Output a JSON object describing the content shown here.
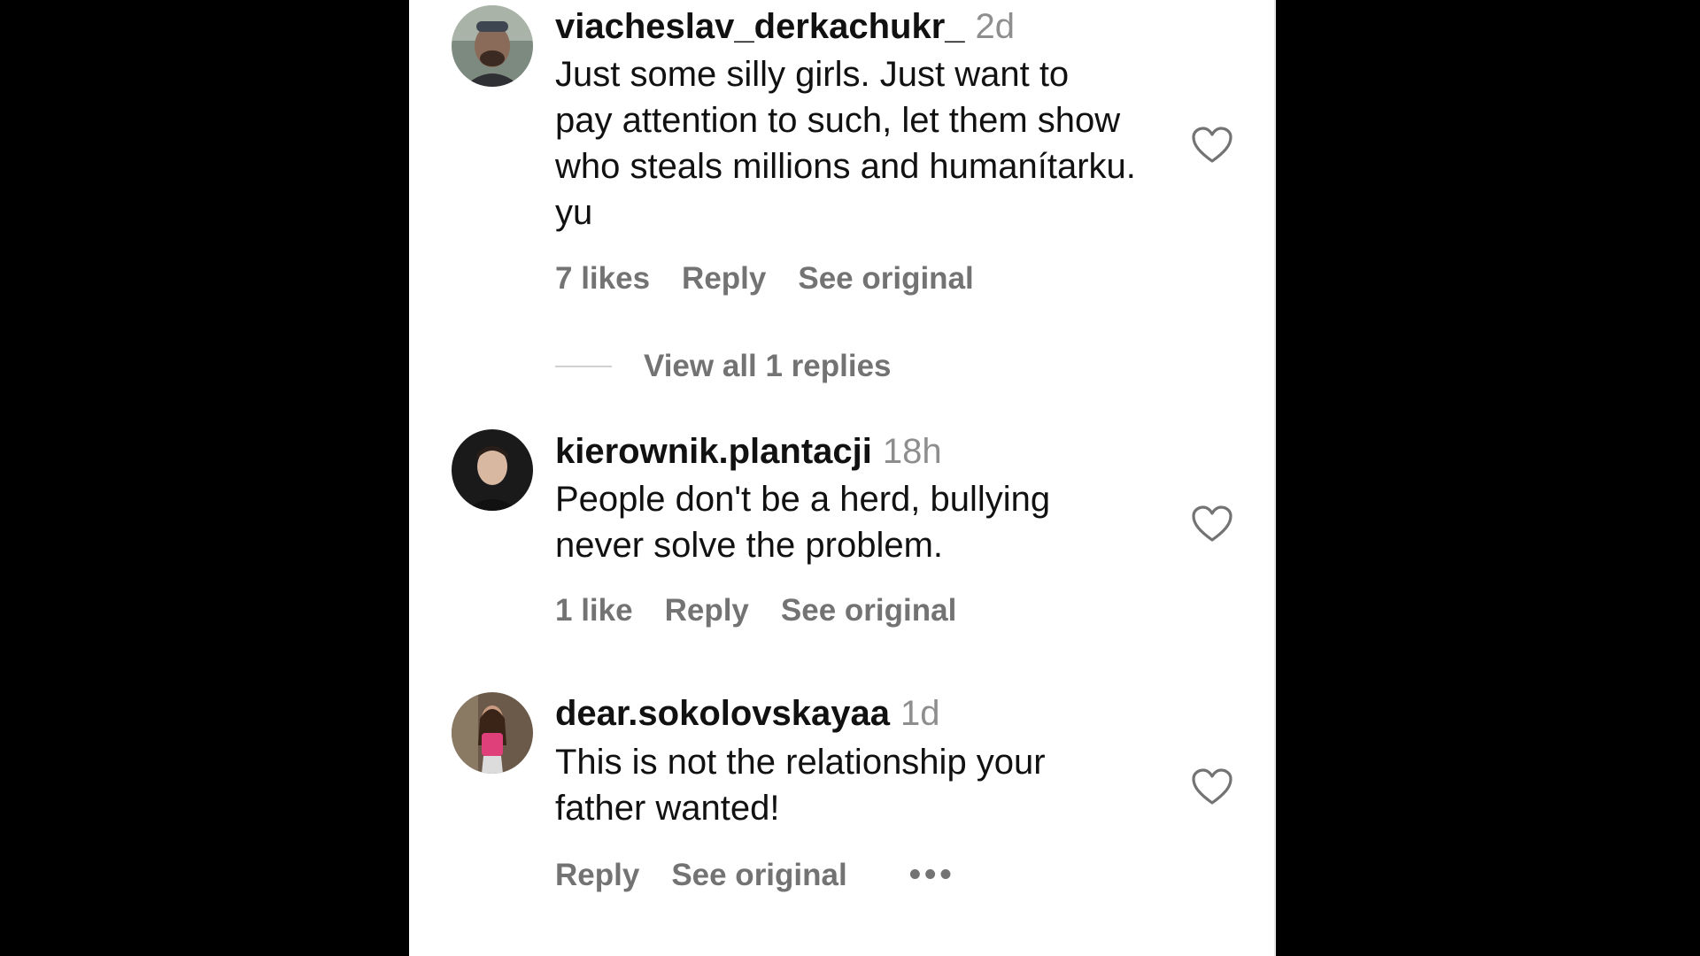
{
  "comments": [
    {
      "username": "viacheslav_derkachukr_",
      "time": "2d",
      "text_lines": [
        "Just some silly girls. Just want to",
        "pay attention to such, let them show",
        "who steals millions and humanítarku.",
        "yu"
      ],
      "likes": "7 likes",
      "reply": "Reply",
      "see_original": "See original",
      "view_replies": "View all 1 replies"
    },
    {
      "username": "kierownik.plantacji",
      "time": "18h",
      "text_lines": [
        "People don't be a herd, bullying",
        "never solve the problem."
      ],
      "likes": "1 like",
      "reply": "Reply",
      "see_original": "See original"
    },
    {
      "username": "dear.sokolovskayaa",
      "time": "1d",
      "text_lines": [
        "This is not the relationship your",
        "father wanted!"
      ],
      "reply": "Reply",
      "see_original": "See original",
      "more": "•••"
    }
  ],
  "icons": {
    "like": "heart-icon",
    "more": "more-options-icon"
  }
}
